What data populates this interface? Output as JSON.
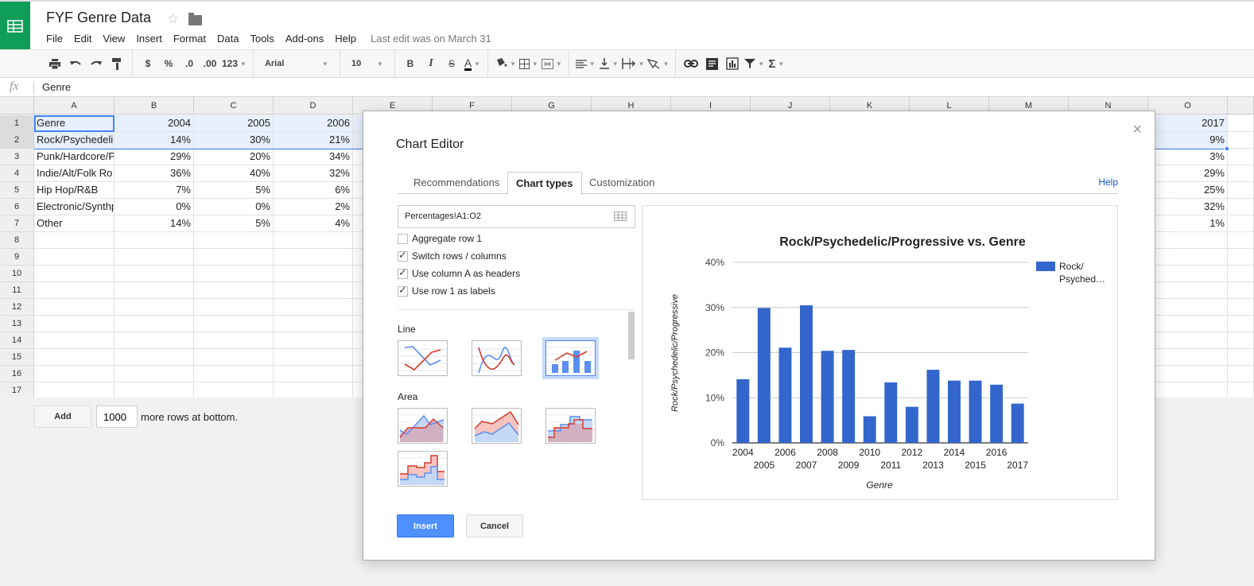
{
  "app": {
    "doc_title": "FYF Genre Data",
    "menu": [
      "File",
      "Edit",
      "View",
      "Insert",
      "Format",
      "Data",
      "Tools",
      "Add-ons",
      "Help"
    ],
    "last_edit": "Last edit was on March 31"
  },
  "toolbar": {
    "currency": "$",
    "percent": "%",
    "dec_decrease": ".0",
    "dec_increase": ".00",
    "more_formats": "123",
    "font": "Arial",
    "font_size": "10",
    "bold": "B",
    "italic": "I",
    "strike": "S",
    "text_color": "A",
    "sum": "Σ"
  },
  "formula_bar": {
    "fx": "fx",
    "value": "Genre"
  },
  "sheet": {
    "columns": [
      "A",
      "B",
      "C",
      "D",
      "E",
      "F",
      "G",
      "H",
      "I",
      "J",
      "K",
      "L",
      "M",
      "N",
      "O"
    ],
    "row_numbers": [
      "1",
      "2",
      "3",
      "4",
      "5",
      "6",
      "7",
      "8",
      "9",
      "10",
      "11",
      "12",
      "13",
      "14",
      "15",
      "16",
      "17"
    ],
    "rows": [
      {
        "A": "Genre",
        "B": "2004",
        "C": "2005",
        "D": "2006",
        "O": "2017"
      },
      {
        "A": "Rock/Psychedeli",
        "B": "14%",
        "C": "30%",
        "D": "21%",
        "O": "9%"
      },
      {
        "A": "Punk/Hardcore/P",
        "B": "29%",
        "C": "20%",
        "D": "34%",
        "O": "3%"
      },
      {
        "A": "Indie/Alt/Folk Ro",
        "B": "36%",
        "C": "40%",
        "D": "32%",
        "O": "29%"
      },
      {
        "A": "Hip Hop/R&B",
        "B": "7%",
        "C": "5%",
        "D": "6%",
        "O": "25%"
      },
      {
        "A": "Electronic/Synthp",
        "B": "0%",
        "C": "0%",
        "D": "2%",
        "O": "32%"
      },
      {
        "A": "Other",
        "B": "14%",
        "C": "5%",
        "D": "4%",
        "O": "1%"
      }
    ],
    "add_button": "Add",
    "add_rows_value": "1000",
    "add_rows_label": "more rows at bottom."
  },
  "dialog": {
    "title": "Chart Editor",
    "close": "×",
    "tabs": [
      {
        "label": "Recommendations",
        "active": false
      },
      {
        "label": "Chart types",
        "active": true
      },
      {
        "label": "Customization",
        "active": false
      }
    ],
    "help": "Help",
    "range": "Percentages!A1:O2",
    "options": [
      {
        "label": "Aggregate row 1",
        "checked": false
      },
      {
        "label": "Switch rows / columns",
        "checked": true
      },
      {
        "label": "Use column A as headers",
        "checked": true
      },
      {
        "label": "Use row 1 as labels",
        "checked": true
      }
    ],
    "sections": [
      {
        "label": "Line",
        "thumbs": [
          "line-chart",
          "smooth-line-chart",
          "combo-chart"
        ],
        "selected": 2
      },
      {
        "label": "Area",
        "thumbs": [
          "area-chart",
          "stacked-area-chart",
          "stepped-area-chart",
          "stacked-stepped-area-chart"
        ]
      }
    ],
    "insert": "Insert",
    "cancel": "Cancel"
  },
  "chart_data": {
    "type": "bar",
    "title": "Rock/Psychedelic/Progressive vs. Genre",
    "xlabel": "Genre",
    "ylabel": "Rock/Psychedelic/Progressive",
    "categories": [
      "2004",
      "2005",
      "2006",
      "2007",
      "2008",
      "2009",
      "2010",
      "2011",
      "2012",
      "2013",
      "2014",
      "2015",
      "2016",
      "2017"
    ],
    "series": [
      {
        "name": "Rock/Psyched…",
        "color": "#3366cc",
        "values": [
          14.1,
          29.9,
          21.1,
          30.5,
          20.4,
          20.6,
          5.9,
          13.4,
          8.0,
          16.2,
          13.8,
          13.8,
          12.9,
          8.7
        ]
      }
    ],
    "yticks": [
      "0%",
      "10%",
      "20%",
      "30%",
      "40%"
    ],
    "ylim": [
      0,
      40
    ],
    "grid": true,
    "legend": "right",
    "legend_label_lines": [
      "Rock/",
      "Psyched…"
    ]
  }
}
